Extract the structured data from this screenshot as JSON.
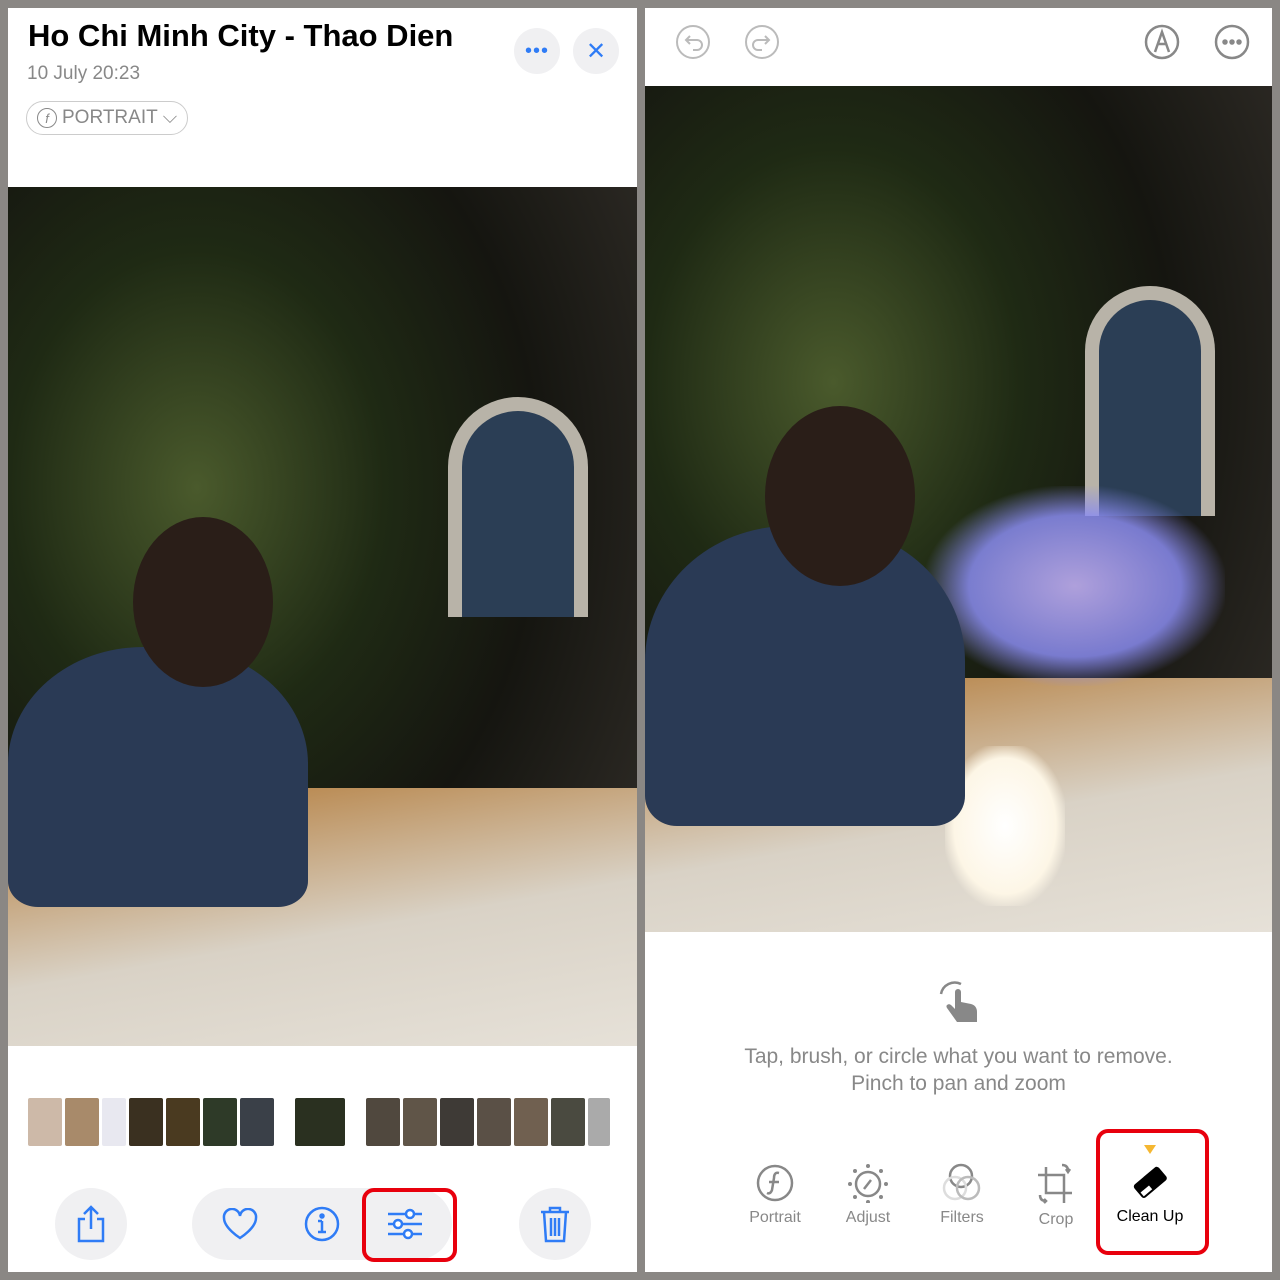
{
  "left": {
    "title": "Ho Chi Minh City - Thao Dien",
    "date": "10 July  20:23",
    "mode_pill": "PORTRAIT",
    "icons": [
      "more-icon",
      "close-icon",
      "share-icon",
      "heart-icon",
      "info-icon",
      "edit-sliders-icon",
      "trash-icon"
    ]
  },
  "right": {
    "hint_line1": "Tap, brush, or circle what you want to remove.",
    "hint_line2": "Pinch to pan and zoom",
    "tools": [
      {
        "label": "Portrait",
        "icon": "portrait-f-icon"
      },
      {
        "label": "Adjust",
        "icon": "adjust-dial-icon"
      },
      {
        "label": "Filters",
        "icon": "filters-circles-icon"
      },
      {
        "label": "Crop",
        "icon": "crop-rotate-icon"
      },
      {
        "label": "Clean Up",
        "icon": "eraser-icon",
        "selected": true
      }
    ]
  },
  "colors": {
    "accent": "#2f7cf6",
    "highlight": "#e8000d",
    "selected_marker": "#f5b731"
  }
}
